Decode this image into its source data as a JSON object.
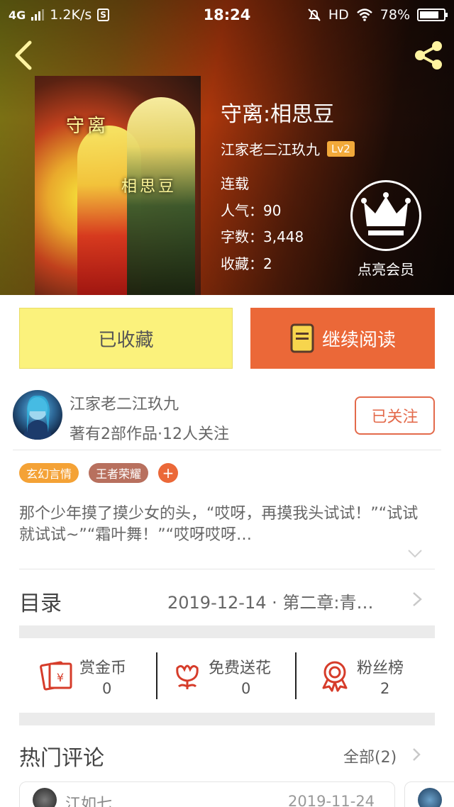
{
  "status_bar": {
    "network": "4G",
    "speed": "1.2K/s",
    "s_icon": "S",
    "time": "18:24",
    "hd": "HD",
    "battery": "78%"
  },
  "book": {
    "title": "守离:相思豆",
    "author": "江家老二江玖九",
    "level": "Lv2",
    "status": "连载",
    "popularity": "人气：90",
    "word_count": "字数：3,448",
    "favorites": "收藏：2",
    "member_label": "点亮会员",
    "cover_text_1": "守离",
    "cover_text_2": "相思豆"
  },
  "buttons": {
    "favorited": "已收藏",
    "continue_reading": "继续阅读"
  },
  "author_card": {
    "name": "江家老二江玖九",
    "stats": "著有2部作品·12人关注",
    "follow": "已关注"
  },
  "tags": [
    "玄幻言情",
    "王者荣耀"
  ],
  "tag_add": "+",
  "description": "那个少年摸了摸少女的头，“哎呀，再摸我头试试！”“试试就试试~”“霜叶舞！”“哎呀哎呀…",
  "toc": {
    "title": "目录",
    "latest": "2019-12-14 · 第二章:青…"
  },
  "actions": [
    {
      "label": "赏金币",
      "count": "0",
      "icon": "red-envelope-icon"
    },
    {
      "label": "免费送花",
      "count": "0",
      "icon": "flower-icon"
    },
    {
      "label": "粉丝榜",
      "count": "2",
      "icon": "medal-icon"
    }
  ],
  "hot_comments": {
    "title": "热门评论",
    "all": "全部(2)",
    "first": {
      "name": "江如七",
      "date": "2019-11-24"
    }
  },
  "colors": {
    "accent": "#eb6838",
    "favorite_yellow": "#fbf27c",
    "level_badge": "#f2a93a",
    "tag_orange": "#f4a236",
    "tag_brown": "#b8705e"
  }
}
